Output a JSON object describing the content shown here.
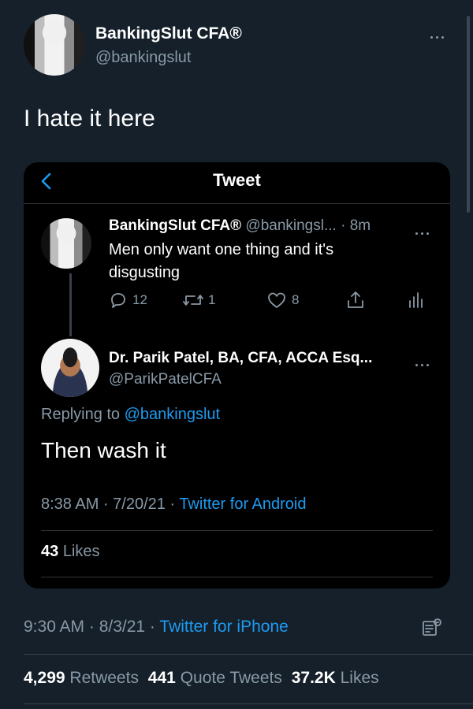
{
  "outer": {
    "display_name": "BankingSlut CFA®",
    "handle": "@bankingslut",
    "tweet_text": "I hate it here",
    "timestamp": "9:30 AM · 8/3/21 ·",
    "client": "Twitter for iPhone",
    "stats": {
      "retweets_count": "4,299",
      "retweets_label": "Retweets",
      "quotes_count": "441",
      "quotes_label": "Quote Tweets",
      "likes_count": "37.2K",
      "likes_label": "Likes"
    }
  },
  "embedded": {
    "header_title": "Tweet",
    "parent": {
      "display_name": "BankingSlut CFA®",
      "handle_time": "@bankingsl... · 8m",
      "text": "Men only want one thing and it's disgusting",
      "replies": "12",
      "retweets": "1",
      "likes": "8"
    },
    "reply": {
      "display_name": "Dr. Parik Patel, BA, CFA, ACCA Esq...",
      "handle": "@ParikPatelCFA",
      "replying_prefix": "Replying to",
      "replying_to": "@bankingslut",
      "text": "Then wash it",
      "timestamp": "8:38 AM · 7/20/21 ·",
      "client": "Twitter for Android",
      "likes_count": "43",
      "likes_label": "Likes"
    }
  },
  "colors": {
    "background": "#15202b",
    "card": "#000000",
    "accent": "#1d9bf0",
    "muted": "#8899a6"
  }
}
